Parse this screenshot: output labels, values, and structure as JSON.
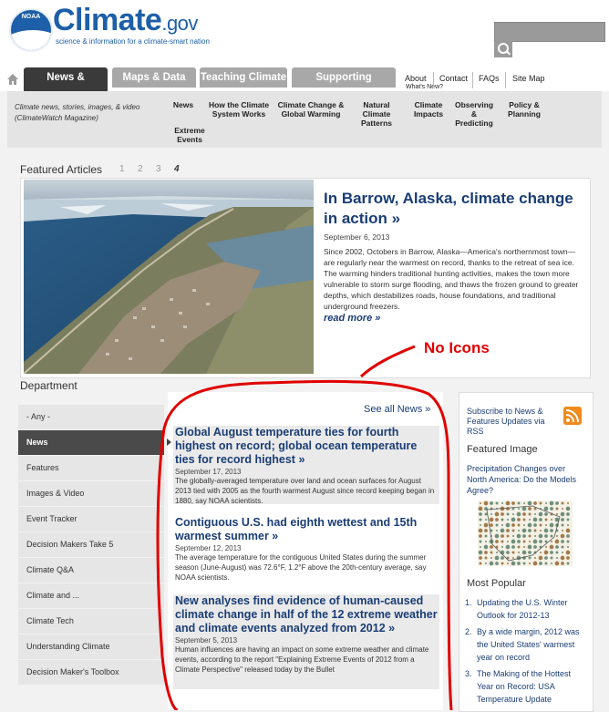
{
  "header": {
    "noaa_label": "NOAA",
    "brand": "Climate",
    "brand_suffix": ".gov",
    "tagline": "science & information for a climate-smart nation"
  },
  "nav": {
    "tabs": [
      {
        "label": "News & Features",
        "active": true
      },
      {
        "label": "Maps & Data",
        "active": false
      },
      {
        "label": "Teaching Climate",
        "active": false
      },
      {
        "label": "Supporting Decisions",
        "active": false
      }
    ],
    "utility": [
      "About",
      "Contact",
      "FAQs",
      "Site Map"
    ],
    "whats_new": "What's New?"
  },
  "subnav": {
    "description": "Climate news, stories, images, & video (ClimateWatch Magazine)",
    "items": [
      "News",
      "How the Climate System Works",
      "Climate Change & Global Warming",
      "Natural Climate Patterns",
      "Climate Impacts",
      "Observing & Predicting",
      "Policy & Planning",
      "Extreme Events"
    ]
  },
  "featured": {
    "heading": "Featured Articles",
    "pages": [
      "1",
      "2",
      "3",
      "4"
    ],
    "current_page": "4",
    "title": "In Barrow, Alaska, climate change in action »",
    "date": "September 6, 2013",
    "body": "Since 2002, Octobers in Barrow, Alaska—America's northernmost town—are regularly near the warmest on record, thanks to the retreat of sea ice. The warming hinders traditional hunting activities, makes the town more vulnerable to storm surge flooding, and thaws the frozen ground to greater depths, which destabilizes roads, house foundations, and traditional underground freezers.",
    "read_more": "read more »"
  },
  "annotation": "No Icons",
  "department": {
    "heading": "Department",
    "items": [
      {
        "label": "- Any -",
        "active": false
      },
      {
        "label": "News",
        "active": true
      },
      {
        "label": "Features",
        "active": false
      },
      {
        "label": "Images & Video",
        "active": false
      },
      {
        "label": "Event Tracker",
        "active": false
      },
      {
        "label": "Decision Makers Take 5",
        "active": false
      },
      {
        "label": "Climate Q&A",
        "active": false
      },
      {
        "label": "Climate and ...",
        "active": false
      },
      {
        "label": "Climate Tech",
        "active": false
      },
      {
        "label": "Understanding Climate",
        "active": false
      },
      {
        "label": "Decision Maker's Toolbox",
        "active": false
      }
    ]
  },
  "news": {
    "see_all": "See all News »",
    "items": [
      {
        "title": "Global August temperature ties for fourth highest on record; global ocean temperature ties for record highest »",
        "date": "September 17, 2013",
        "body": "The globally-averaged temperature over land and ocean surfaces for August 2013 tied with 2005 as the fourth warmest August since record keeping began in 1880, say NOAA scientists."
      },
      {
        "title": "Contiguous U.S. had eighth wettest and 15th warmest summer »",
        "date": "September 12, 2013",
        "body": "The average temperature for the contiguous United States during the summer season (June-August) was 72.6°F, 1.2°F above the 20th-century average, say NOAA scientists."
      },
      {
        "title": "New analyses find evidence of human-caused climate change in half of the 12 extreme weather and climate events analyzed from 2012 »",
        "date": "September 5, 2013",
        "body": "Human influences are having an impact on some extreme weather and climate events, according to the report \"Explaining Extreme Events of 2012 from a Climate Perspective\" released today by the Bullet"
      }
    ]
  },
  "sidebar": {
    "subscribe": "Subscribe to News & Features Updates via RSS",
    "featured_image_heading": "Featured Image",
    "featured_image_link": "Precipitation Changes over North America: Do the Models Agree?",
    "most_popular_heading": "Most Popular",
    "most_popular": [
      {
        "n": "1.",
        "label": "Updating the U.S. Winter Outlook for 2012-13"
      },
      {
        "n": "2.",
        "label": "By a wide margin, 2012 was the United States' warmest year on record"
      },
      {
        "n": "3.",
        "label": "The Making of the Hottest Year on Record: USA Temperature Update"
      }
    ]
  },
  "colors": {
    "brand_blue": "#1d5fa8",
    "link_blue": "#1a3d75",
    "annotation_red": "#e00000",
    "tab_active": "#3a3a3a",
    "tab_inactive": "#a8a8a8",
    "rss_orange": "#f08a1c"
  }
}
